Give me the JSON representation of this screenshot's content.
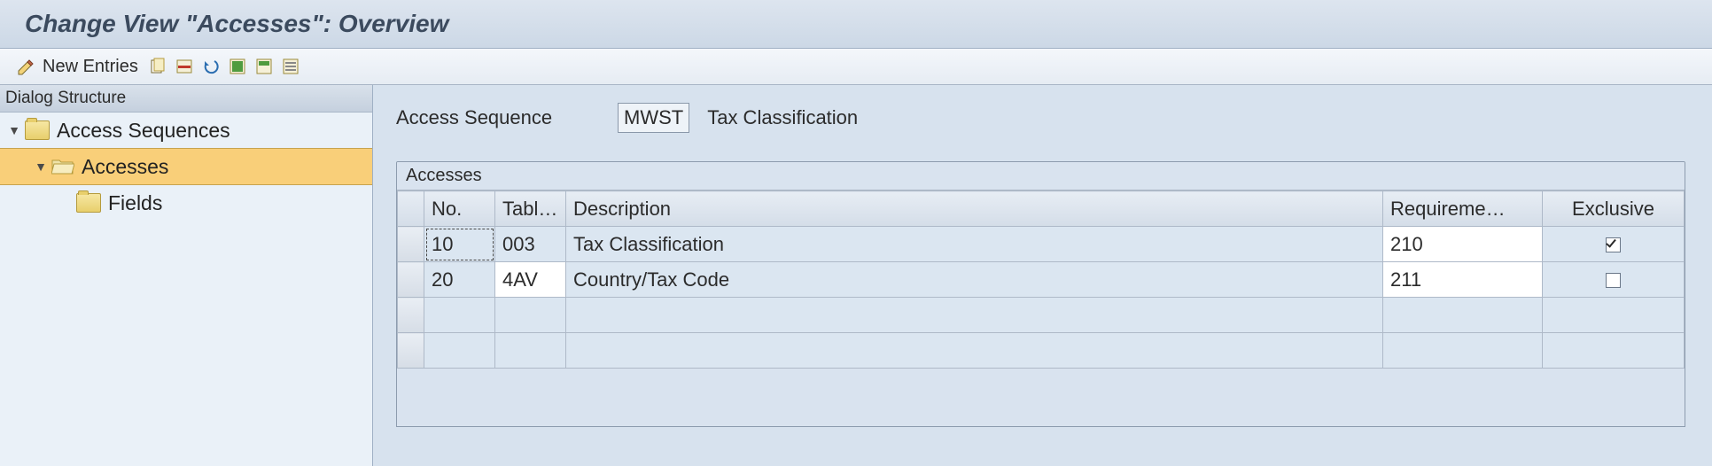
{
  "header": {
    "title": "Change View \"Accesses\": Overview"
  },
  "toolbar": {
    "new_entries_label": "New Entries"
  },
  "tree": {
    "header": "Dialog Structure",
    "items": [
      {
        "label": "Access Sequences",
        "level": 0,
        "expanded": true,
        "selected": false,
        "open": false
      },
      {
        "label": "Accesses",
        "level": 1,
        "expanded": true,
        "selected": true,
        "open": true
      },
      {
        "label": "Fields",
        "level": 2,
        "expanded": false,
        "selected": false,
        "open": false
      }
    ]
  },
  "detail": {
    "label": "Access Sequence",
    "code": "MWST",
    "description": "Tax Classification"
  },
  "table": {
    "title": "Accesses",
    "columns": {
      "no": "No.",
      "table": "Tabl…",
      "description": "Description",
      "requirement": "Requireme…",
      "exclusive": "Exclusive"
    },
    "rows": [
      {
        "no": "10",
        "table": "003",
        "description": "Tax Classification",
        "requirement": "210",
        "exclusive": true
      },
      {
        "no": "20",
        "table": "4AV",
        "description": "Country/Tax Code",
        "requirement": "211",
        "exclusive": false
      }
    ]
  }
}
